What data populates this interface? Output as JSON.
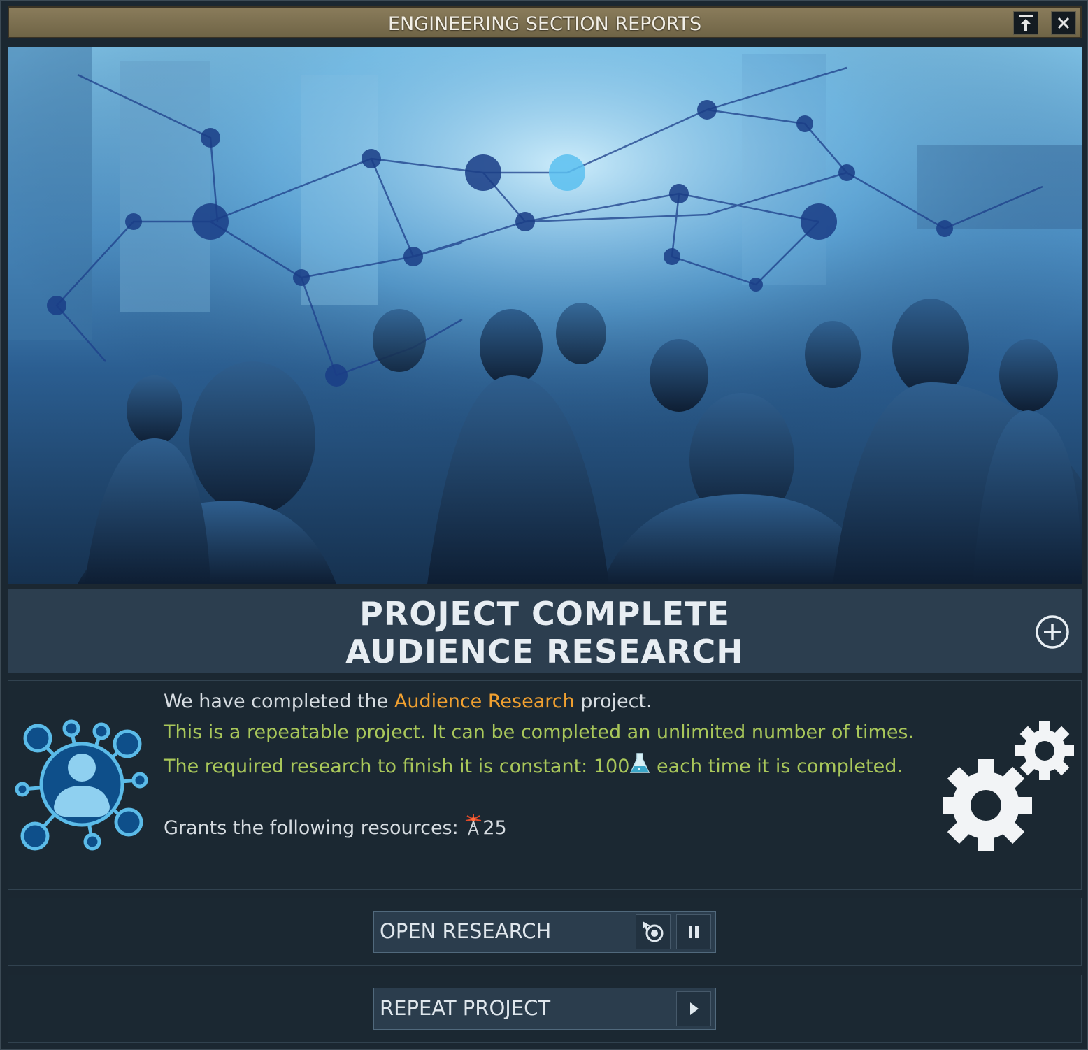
{
  "window": {
    "title": "ENGINEERING SECTION REPORTS",
    "pin_icon": "pin-to-top-icon",
    "close_icon": "close-icon"
  },
  "header": {
    "line1": "PROJECT COMPLETE",
    "line2": "AUDIENCE RESEARCH",
    "expand_icon": "plus-circle-icon"
  },
  "description": {
    "l1_pre": "We have completed the ",
    "l1_project": "Audience Research",
    "l1_post": " project.",
    "l2": "This is a repeatable project. It can be completed an unlimited number of times.",
    "l3_pre": "The required research to finish it is constant: 100",
    "l3_post": " each time it is completed.",
    "l4_pre": "Grants the following resources: ",
    "l4_amount": "25",
    "research_icon": "flask-icon",
    "resource_icon": "broadcast-tower-icon",
    "project_icon": "audience-network-icon",
    "type_icon": "gears-icon"
  },
  "buttons": {
    "open_research": "OPEN RESEARCH",
    "repeat_project": "REPEAT PROJECT",
    "goto_icon": "target-cursor-icon",
    "pause_icon": "pause-icon",
    "play_icon": "play-icon"
  },
  "colors": {
    "highlight": "#f0a030",
    "repeatable_text": "#a9c75a",
    "title_bar": "#7d7151"
  }
}
